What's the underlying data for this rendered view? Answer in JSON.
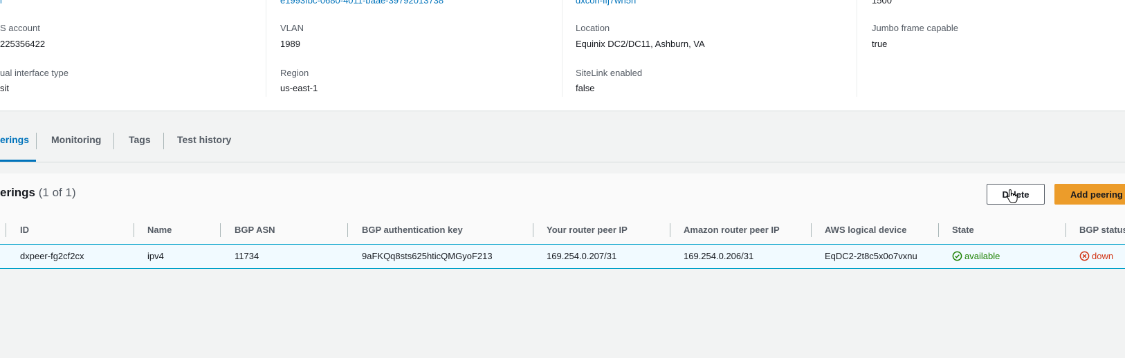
{
  "details": {
    "col1": {
      "top_value": "l",
      "label1": "S account",
      "value1": "225356422",
      "label2": "ual interface type",
      "value2": "sit"
    },
    "col2": {
      "top_value": "e1993fbc-0680-4011-baae-39792013738",
      "label1": "VLAN",
      "value1": "1989",
      "label2": "Region",
      "value2": "us-east-1"
    },
    "col3": {
      "top_value": "dxcon-ffj7wh5h",
      "label1": "Location",
      "value1": "Equinix DC2/DC11, Ashburn, VA",
      "label2": "SiteLink enabled",
      "value2": "false"
    },
    "col4": {
      "top_value": "1500",
      "label1": "Jumbo frame capable",
      "value1": "true"
    }
  },
  "tabs": [
    {
      "label": "erings",
      "active": true
    },
    {
      "label": "Monitoring",
      "active": false
    },
    {
      "label": "Tags",
      "active": false
    },
    {
      "label": "Test history",
      "active": false
    }
  ],
  "panel": {
    "title": "erings",
    "count": "(1 of 1)",
    "delete_label": "Delete",
    "add_label": "Add peering"
  },
  "table": {
    "columns": [
      "ID",
      "Name",
      "BGP ASN",
      "BGP authentication key",
      "Your router peer IP",
      "Amazon router peer IP",
      "AWS logical device",
      "State",
      "BGP status"
    ],
    "rows": [
      {
        "id": "dxpeer-fg2cf2cx",
        "name": "ipv4",
        "bgp_asn": "11734",
        "auth_key": "9aFKQq8sts625hticQMGyoF213",
        "router_ip": "169.254.0.207/31",
        "amazon_ip": "169.254.0.206/31",
        "logical_device": "EqDC2-2t8c5x0o7vxnu",
        "state": "available",
        "bgp_status": "down"
      }
    ]
  },
  "colors": {
    "accent": "#0073bb",
    "primary_button": "#ec9c2a",
    "success": "#1d8102",
    "error": "#d13212",
    "row_highlight": "#f1faff"
  },
  "icons": {
    "state": "check-circle-icon",
    "bgp_status": "x-circle-icon",
    "cursor": "hand-pointer-icon"
  }
}
